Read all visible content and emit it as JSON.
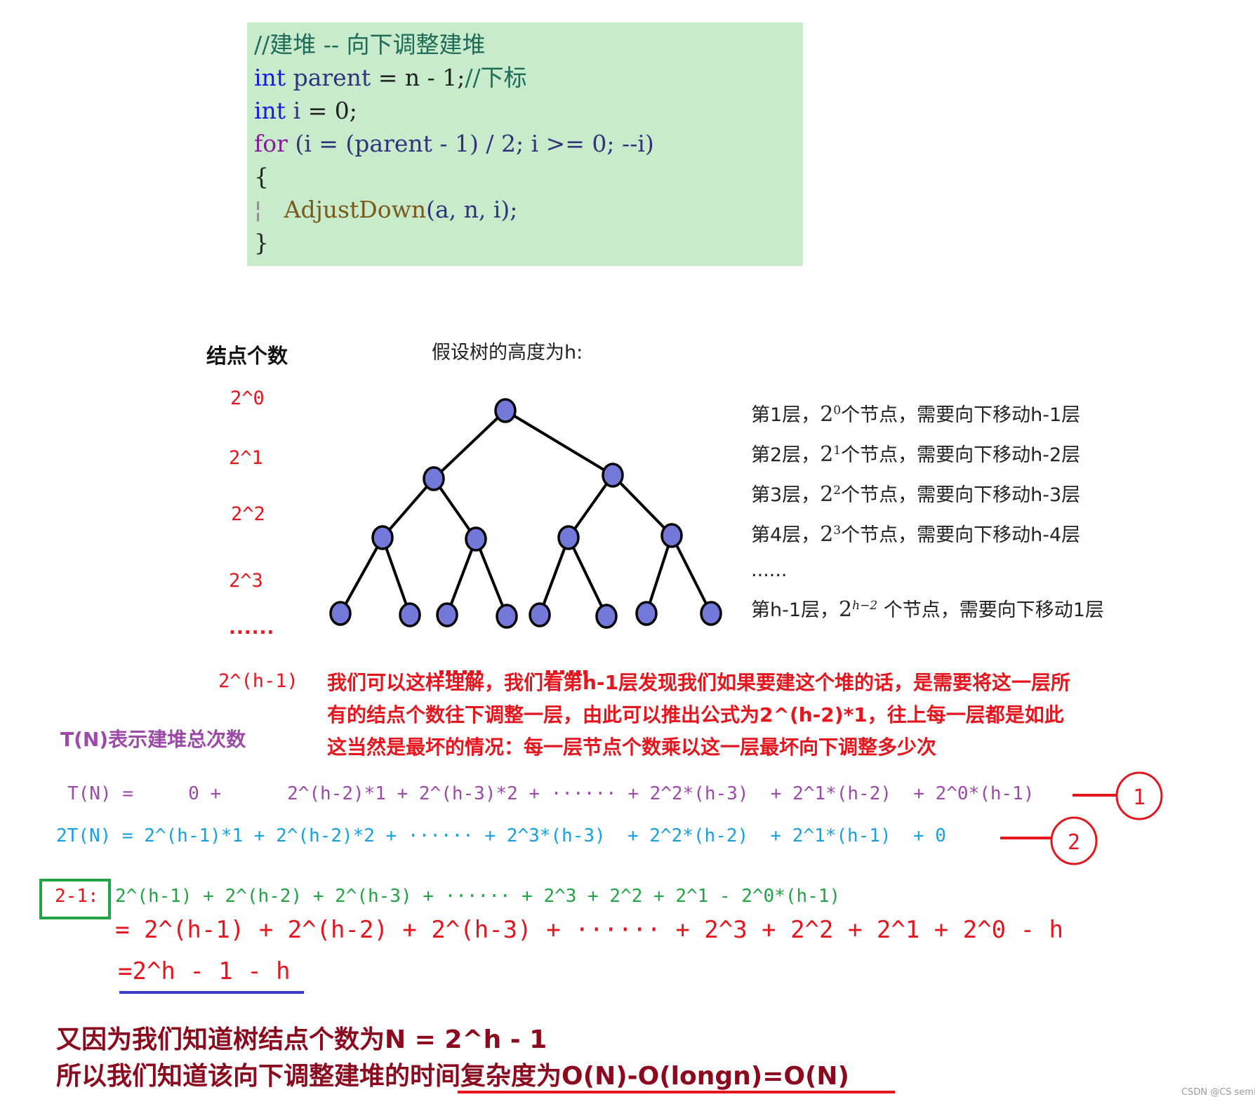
{
  "code": {
    "comment_line": "//建堆 -- 向下调整建堆",
    "line2": {
      "kw": "int",
      "var": "parent",
      "rest": " = n - 1;",
      "comment": "//下标"
    },
    "line3": {
      "kw": "int",
      "var": "i",
      "rest": " = 0;"
    },
    "line4": {
      "kw": "for",
      "rest": " (i = (parent - 1) / 2; i >= 0; --i)"
    },
    "line5": "{",
    "line6": {
      "fn": "AdjustDown",
      "args": "(a,  n,  i);"
    },
    "line7": "}"
  },
  "node_count_header": "结点个数",
  "tree_height_header": "假设树的高度为h:",
  "node_count_labels": [
    "2^0",
    "2^1",
    "2^2",
    "2^3",
    "......",
    "2^(h-1)"
  ],
  "tree": {
    "levels_drawn": 4,
    "node_color": "#7479d9",
    "ellipsis": "......"
  },
  "layers": [
    {
      "prefix": "第1层，",
      "base": "2",
      "exp": "0",
      "suffix": "个节点，需要向下移动h-1层"
    },
    {
      "prefix": "第2层，",
      "base": "2",
      "exp": "1",
      "suffix": "个节点，需要向下移动h-2层"
    },
    {
      "prefix": "第3层，",
      "base": "2",
      "exp": "2",
      "suffix": "个节点，需要向下移动h-3层"
    },
    {
      "prefix": "第4层，",
      "base": "2",
      "exp": "3",
      "suffix": "个节点，需要向下移动h-4层"
    },
    {
      "prefix": "......",
      "base": "",
      "exp": "",
      "suffix": ""
    },
    {
      "prefix": "第h-1层，",
      "base": "2",
      "exp": "h−2",
      "suffix": " 个节点，需要向下移动1层"
    }
  ],
  "explanation": [
    "我们可以这样理解，我们看第h-1层发现我们如果要建这个堆的话，是需要将这一层所",
    "有的结点个数往下调整一层，由此可以推出公式为2^(h-2)*1，往上每一层都是如此",
    "这当然是最坏的情况：每一层节点个数乘以这一层最坏向下调整多少次"
  ],
  "tn_description": "T(N)表示建堆总次数",
  "equations": {
    "eq1": "T(N) =     0 +      2^(h-2)*1 + 2^(h-3)*2 + ······ + 2^2*(h-3)  + 2^1*(h-2)  + 2^0*(h-1)",
    "eq1_marker": "1",
    "eq2": "2T(N) = 2^(h-1)*1 + 2^(h-2)*2 + ······ + 2^3*(h-3)  + 2^2*(h-2)  + 2^1*(h-1)  + 0",
    "eq2_marker": "2",
    "sub_label": "2-1:",
    "eq3": "2^(h-1) + 2^(h-2) + 2^(h-3) + ······ + 2^3 + 2^2 + 2^1 - 2^0*(h-1)",
    "eq4": "= 2^(h-1) + 2^(h-2) + 2^(h-3) + ······ + 2^3 + 2^2 + 2^1 + 2^0 - h",
    "eq5": "=2^h - 1 - h"
  },
  "conclusion": {
    "line1": "又因为我们知道树结点个数为N = 2^h - 1",
    "line2_plain": "所以我们知道该向下调整建堆的",
    "line2_underlined": "时间复杂度为O(N)-O(longn)=O(N)"
  },
  "watermark": "CSDN @CS semi",
  "colors": {
    "red": "#e5161e",
    "purple": "#9b4aa8",
    "blue": "#16a0e0",
    "green": "#21a346",
    "dark_red": "#8b0a1e",
    "underline_blue": "#3a3ac8",
    "code_bg": "#c7ebcb"
  }
}
